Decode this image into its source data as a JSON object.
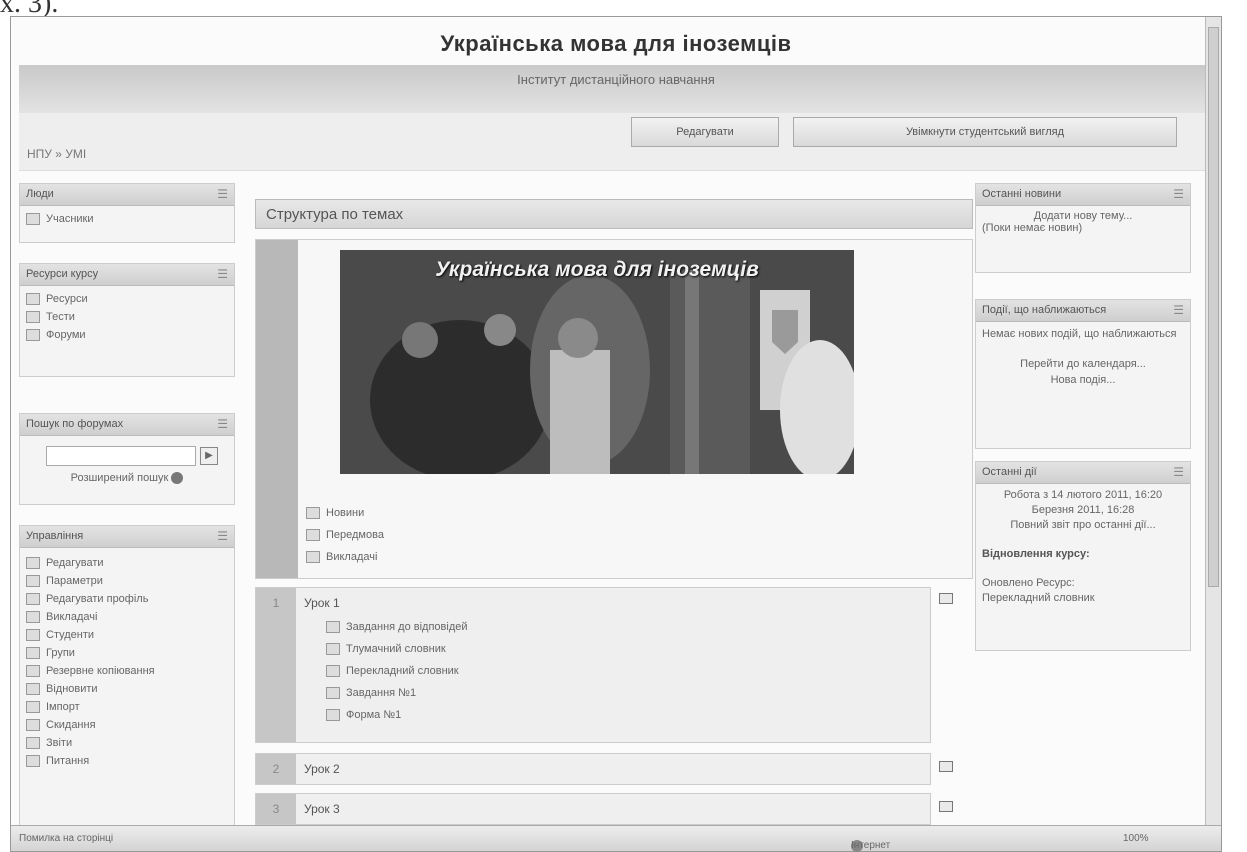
{
  "page_edge_text": "x. 3).",
  "header": {
    "title": "Українська мова для іноземців",
    "subtitle": "Інститут дистанційного навчання",
    "breadcrumb": "НПУ » УМІ",
    "edit_button": "Редагувати",
    "student_view_button": "Увімкнути студентський вигляд"
  },
  "left_blocks": {
    "people": {
      "title": "Люди",
      "items": [
        "Учасники"
      ]
    },
    "activities": {
      "title": "Ресурси курсу",
      "items": [
        "Ресурси",
        "Тести",
        "Форуми"
      ]
    },
    "search": {
      "title": "Пошук по форумах",
      "input_value": "",
      "advanced_label": "Розширений пошук"
    },
    "admin": {
      "title": "Управління",
      "items": [
        "Редагувати",
        "Параметри",
        "Редагувати профіль",
        "Викладачі",
        "Студенти",
        "Групи",
        "Резервне копіювання",
        "Відновити",
        "Імпорт",
        "Скидання",
        "Звіти",
        "Питання"
      ]
    }
  },
  "center": {
    "heading": "Структура по темах",
    "banner_title": "Українська мова для іноземців",
    "topic0_links": [
      "Новини",
      "Передмова",
      "Викладачі"
    ],
    "topics": [
      {
        "number": "1",
        "title": "Урок 1",
        "items": [
          "Завдання до відповідей",
          "Тлумачний словник",
          "Перекладний словник",
          "Завдання №1",
          "Форма №1"
        ]
      },
      {
        "number": "2",
        "title": "Урок 2",
        "items": []
      },
      {
        "number": "3",
        "title": "Урок 3",
        "items": []
      }
    ]
  },
  "right_blocks": {
    "news": {
      "title": "Останні новини",
      "link": "Додати нову тему...",
      "note": "(Поки немає новин)"
    },
    "events": {
      "title": "Події, що наближаються",
      "text": "Немає нових подій, що наближаються",
      "link1": "Перейти до календаря...",
      "link2": "Нова подія..."
    },
    "recent": {
      "title": "Останні дії",
      "text1": "Робота з 14 лютого 2011, 16:20",
      "text2": "Березня 2011, 16:28",
      "link": "Повний звіт про останні дії...",
      "subheading": "Відновлення курсу:",
      "lines": [
        "Оновлено Ресурс:",
        "Перекладний словник"
      ]
    }
  },
  "statusbar": {
    "left": "Помилка на сторінці",
    "middle": "Інтернет",
    "right": "100%"
  }
}
